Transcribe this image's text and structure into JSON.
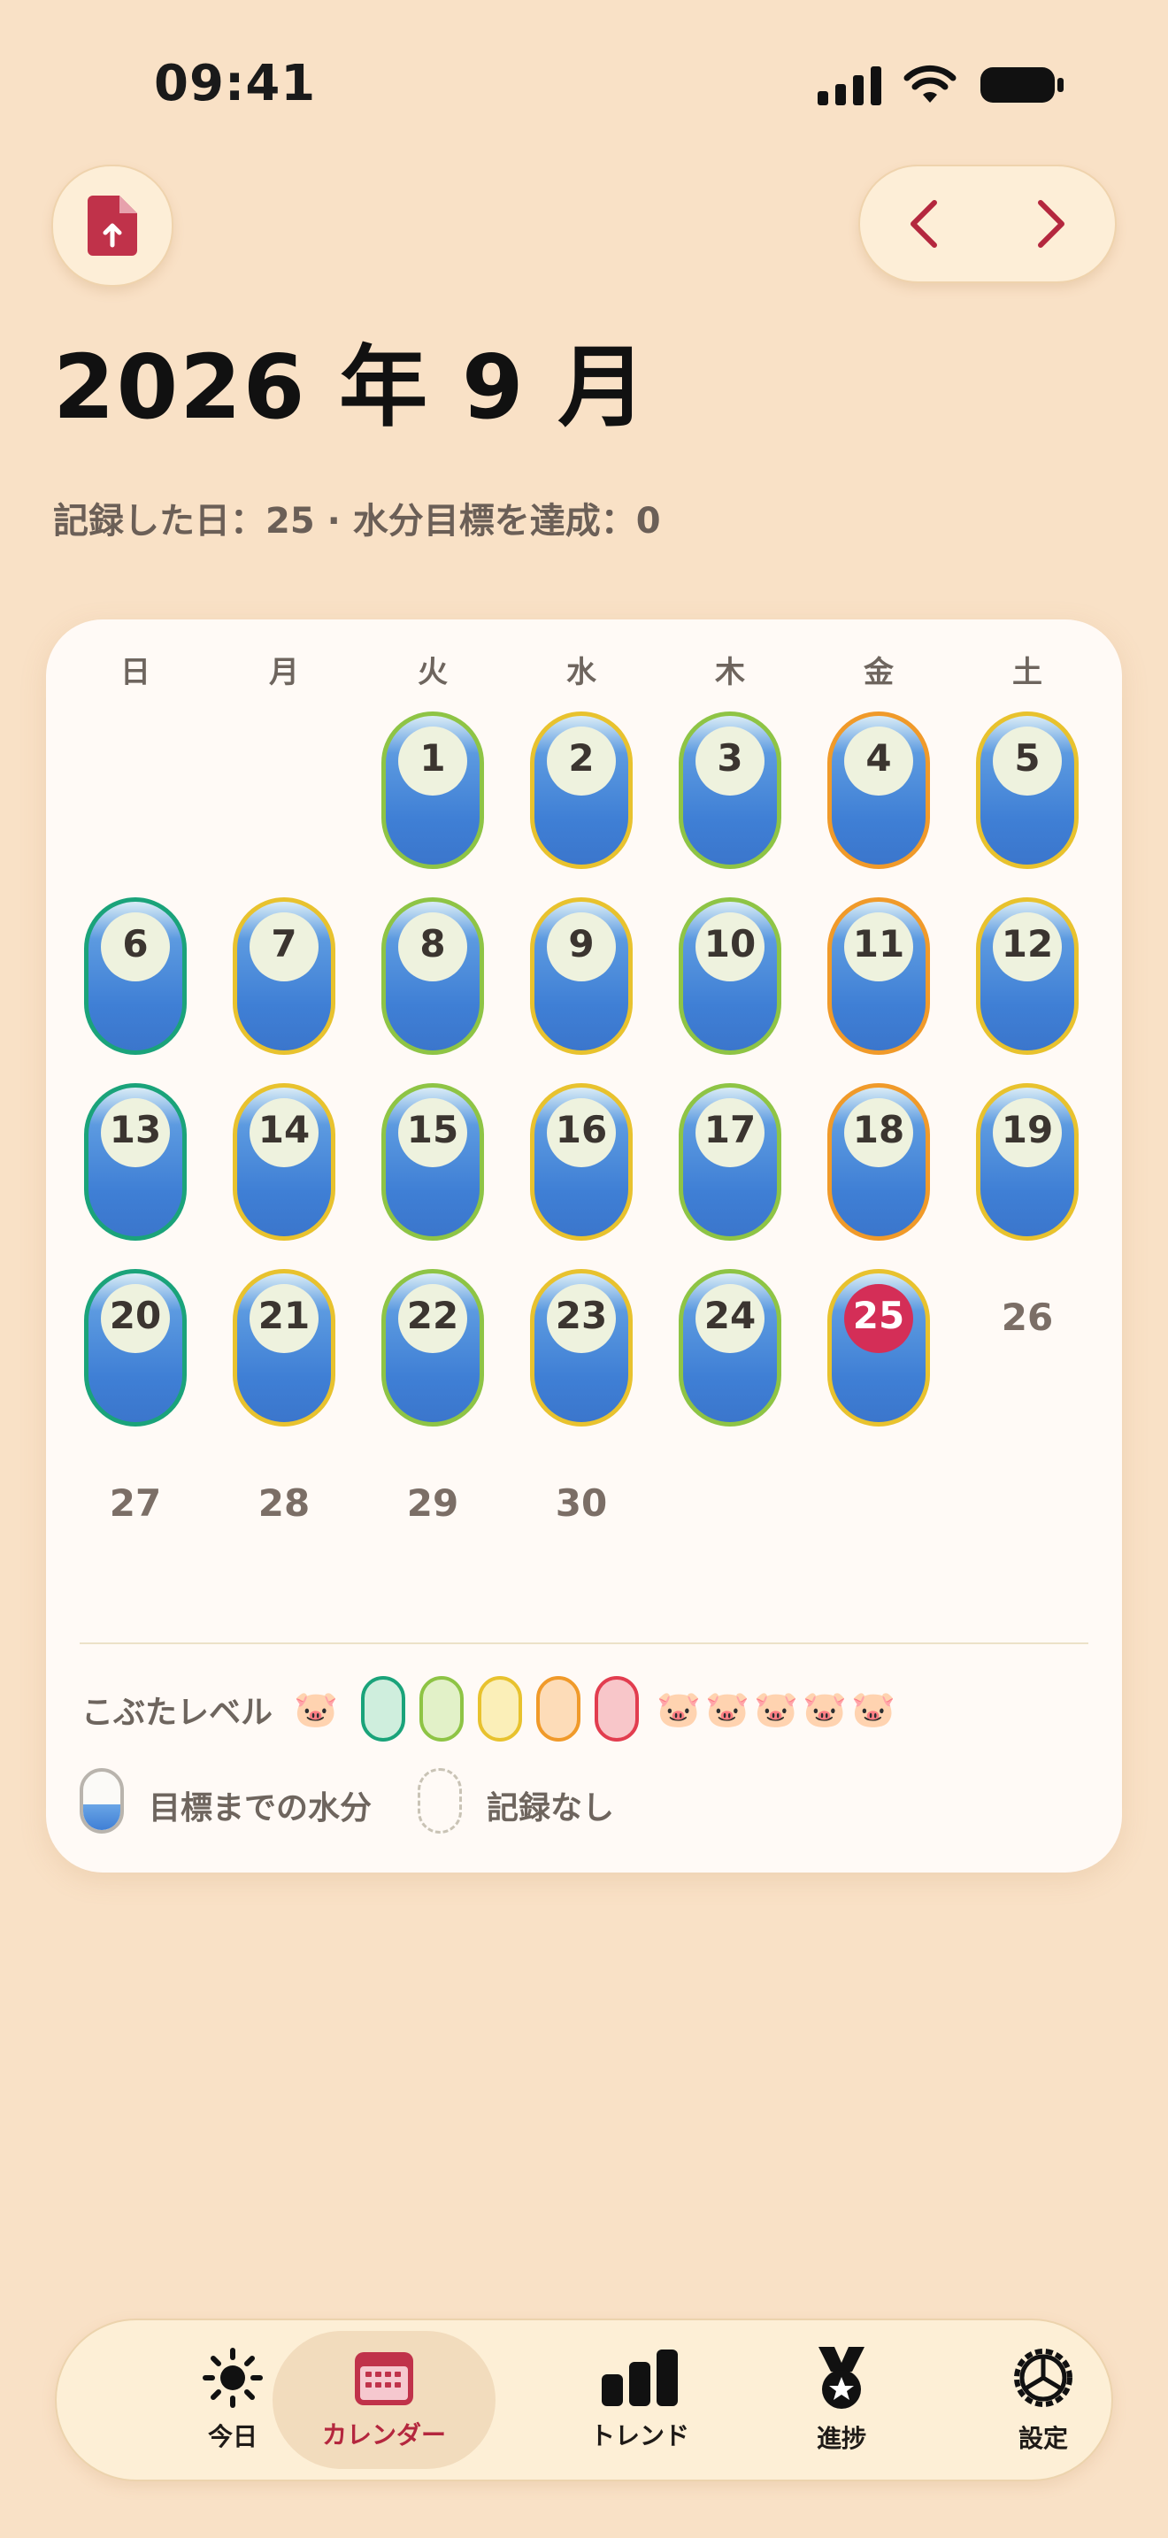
{
  "status": {
    "time": "09:41"
  },
  "header": {
    "title": "2026 年 9 月",
    "summary": "記録した日：25 · 水分目標を達成：0"
  },
  "weekdays": [
    "日",
    "月",
    "火",
    "水",
    "木",
    "金",
    "土"
  ],
  "days": [
    {
      "n": "1",
      "level": 2
    },
    {
      "n": "2",
      "level": 3
    },
    {
      "n": "3",
      "level": 2
    },
    {
      "n": "4",
      "level": 4
    },
    {
      "n": "5",
      "level": 3
    },
    {
      "n": "6",
      "level": 1
    },
    {
      "n": "7",
      "level": 3
    },
    {
      "n": "8",
      "level": 2
    },
    {
      "n": "9",
      "level": 3
    },
    {
      "n": "10",
      "level": 2
    },
    {
      "n": "11",
      "level": 4
    },
    {
      "n": "12",
      "level": 3
    },
    {
      "n": "13",
      "level": 1
    },
    {
      "n": "14",
      "level": 3
    },
    {
      "n": "15",
      "level": 2
    },
    {
      "n": "16",
      "level": 3
    },
    {
      "n": "17",
      "level": 2
    },
    {
      "n": "18",
      "level": 4
    },
    {
      "n": "19",
      "level": 3
    },
    {
      "n": "20",
      "level": 1
    },
    {
      "n": "21",
      "level": 3
    },
    {
      "n": "22",
      "level": 2
    },
    {
      "n": "23",
      "level": 3
    },
    {
      "n": "24",
      "level": 2
    },
    {
      "n": "25",
      "level": 3,
      "today": true
    }
  ],
  "empty_days": [
    "26",
    "27",
    "28",
    "29",
    "30"
  ],
  "level_colors": [
    "#1aa37a",
    "#8ec445",
    "#e8c22e",
    "#f09a2a",
    "#e23d4f"
  ],
  "level_fills": [
    "#cfeedd",
    "#e2f1c8",
    "#fbefb8",
    "#fddcb8",
    "#f8c6c9"
  ],
  "legend": {
    "levels_label": "こぶたレベル",
    "pig": "🐷",
    "water_label": "目標までの水分",
    "no_record_label": "記録なし"
  },
  "tabs": [
    {
      "label": "今日",
      "icon": "sun-icon"
    },
    {
      "label": "カレンダー",
      "icon": "calendar-icon",
      "active": true
    },
    {
      "label": "トレンド",
      "icon": "bar-chart-icon"
    },
    {
      "label": "進捗",
      "icon": "medal-icon"
    },
    {
      "label": "設定",
      "icon": "settings-icon"
    }
  ],
  "colors": {
    "accent": "#b4273e",
    "today": "#d42e57",
    "background": "#f9e1c6"
  }
}
